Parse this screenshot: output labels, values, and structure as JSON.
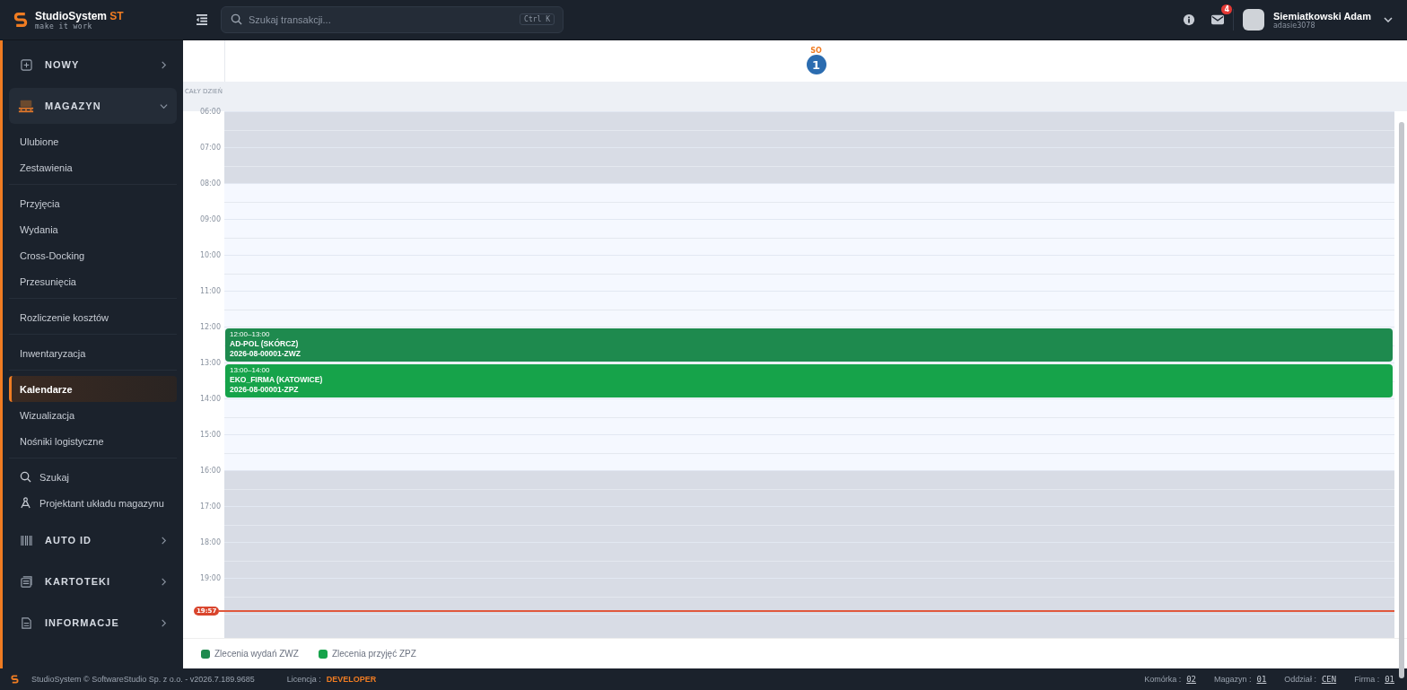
{
  "brand": {
    "name": "StudioSystem",
    "accent": "ST",
    "tagline": "make it work"
  },
  "search": {
    "placeholder": "Szukaj transakcji...",
    "shortcut": "Ctrl K"
  },
  "header": {
    "mail_count": "4",
    "user_name": "Siemiatkowski Adam",
    "user_login": "adasie3078"
  },
  "sidebar": {
    "items": [
      {
        "kind": "section",
        "label": "NOWY",
        "expanded": false
      },
      {
        "kind": "section",
        "label": "MAGAZYN",
        "expanded": true,
        "groups": [
          [
            {
              "kind": "link",
              "label": "Ulubione",
              "selected": false
            },
            {
              "kind": "link",
              "label": "Zestawienia",
              "selected": false
            }
          ],
          [
            {
              "kind": "link",
              "label": "Przyjęcia",
              "selected": false
            },
            {
              "kind": "link",
              "label": "Wydania",
              "selected": false
            },
            {
              "kind": "link",
              "label": "Cross-Docking",
              "selected": false
            },
            {
              "kind": "link",
              "label": "Przesunięcia",
              "selected": false
            }
          ],
          [
            {
              "kind": "link",
              "label": "Rozliczenie kosztów",
              "selected": false
            }
          ],
          [
            {
              "kind": "link",
              "label": "Inwentaryzacja",
              "selected": false
            }
          ],
          [
            {
              "kind": "link",
              "label": "Kalendarze",
              "selected": true
            },
            {
              "kind": "link",
              "label": "Wizualizacja",
              "selected": false
            },
            {
              "kind": "link",
              "label": "Nośniki logistyczne",
              "selected": false
            }
          ],
          [
            {
              "kind": "search",
              "label": "Szukaj",
              "selected": false
            },
            {
              "kind": "designer",
              "label": "Projektant układu magazynu",
              "selected": false
            }
          ]
        ]
      },
      {
        "kind": "section",
        "label": "AUTO ID",
        "expanded": false
      },
      {
        "kind": "section",
        "label": "KARTOTEKI",
        "expanded": false
      },
      {
        "kind": "section",
        "label": "INFORMACJE",
        "expanded": false
      }
    ]
  },
  "calendar": {
    "day_name": "SO",
    "day_number": "1",
    "all_day_label": "CAŁY DZIEŃ",
    "hours": [
      {
        "label": "06:00",
        "off_hours": true
      },
      {
        "label": "07:00",
        "off_hours": true
      },
      {
        "label": "08:00",
        "off_hours": false
      },
      {
        "label": "09:00",
        "off_hours": false
      },
      {
        "label": "10:00",
        "off_hours": false
      },
      {
        "label": "11:00",
        "off_hours": false
      },
      {
        "label": "12:00",
        "off_hours": false,
        "events": [
          {
            "time": "12:00–13:00",
            "title": "AD-POL (SKÓRCZ)",
            "number": "2026-08-00001-ZWZ",
            "color": "#1e8a4e"
          }
        ]
      },
      {
        "label": "13:00",
        "off_hours": false,
        "events": [
          {
            "time": "13:00–14:00",
            "title": "EKO_FIRMA (KATOWICE)",
            "number": "2026-08-00001-ZPZ",
            "color": "#16a34a"
          }
        ]
      },
      {
        "label": "14:00",
        "off_hours": false
      },
      {
        "label": "15:00",
        "off_hours": false
      },
      {
        "label": "16:00",
        "off_hours": true
      },
      {
        "label": "17:00",
        "off_hours": true
      },
      {
        "label": "18:00",
        "off_hours": true
      },
      {
        "label": "19:00",
        "off_hours": true,
        "now": "19:57"
      }
    ],
    "legend": [
      {
        "label": "Zlecenia wydań ZWZ",
        "color": "#1e8a4e"
      },
      {
        "label": "Zlecenia przyjęć ZPZ",
        "color": "#16a34a"
      }
    ]
  },
  "status_bar": {
    "copyright": "StudioSystem © SoftwareStudio Sp. z o.o. - v2026.7.189.9685",
    "license_label": "Licencja :",
    "license_value": "DEVELOPER",
    "fields": [
      {
        "label": "Komórka :",
        "value": "02"
      },
      {
        "label": "Magazyn :",
        "value": "01"
      },
      {
        "label": "Oddział :",
        "value": "CEN"
      },
      {
        "label": "Firma :",
        "value": "01"
      }
    ]
  }
}
